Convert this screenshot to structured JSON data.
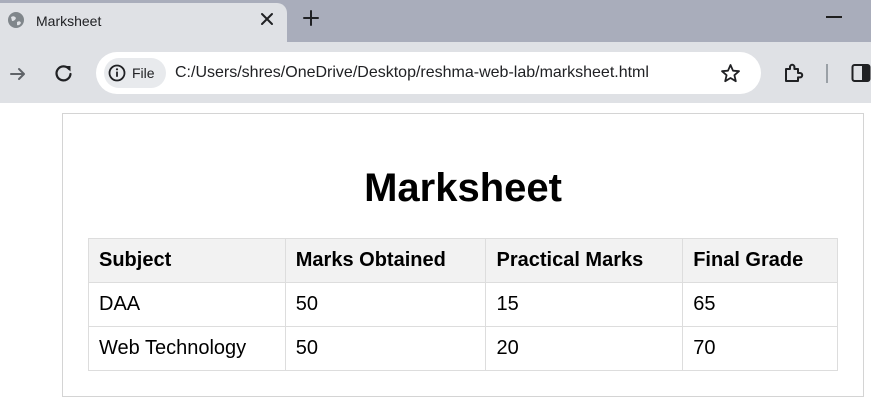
{
  "browser": {
    "tab": {
      "title": "Marksheet"
    },
    "address_bar": {
      "site_chip_label": "File",
      "url": "C:/Users/shres/OneDrive/Desktop/reshma-web-lab/marksheet.html"
    },
    "icons": {
      "favicon": "globe-icon",
      "tab_close": "close-icon",
      "new_tab": "plus-icon",
      "minimize": "minimize-icon",
      "forward": "arrow-right-icon",
      "reload": "reload-icon",
      "info": "info-icon",
      "bookmark": "star-icon",
      "extensions": "puzzle-icon",
      "side_panel": "side-panel-icon"
    }
  },
  "page": {
    "title": "Marksheet",
    "table": {
      "headers": [
        "Subject",
        "Marks Obtained",
        "Practical Marks",
        "Final Grade"
      ],
      "rows": [
        [
          "DAA",
          "50",
          "15",
          "65"
        ],
        [
          "Web Technology",
          "50",
          "20",
          "70"
        ]
      ]
    }
  },
  "colors": {
    "tabstrip_bg": "#a9adbb",
    "toolbar_bg": "#dfe1e5",
    "table_header_bg": "#f2f2f2",
    "table_border": "#dddddd"
  }
}
